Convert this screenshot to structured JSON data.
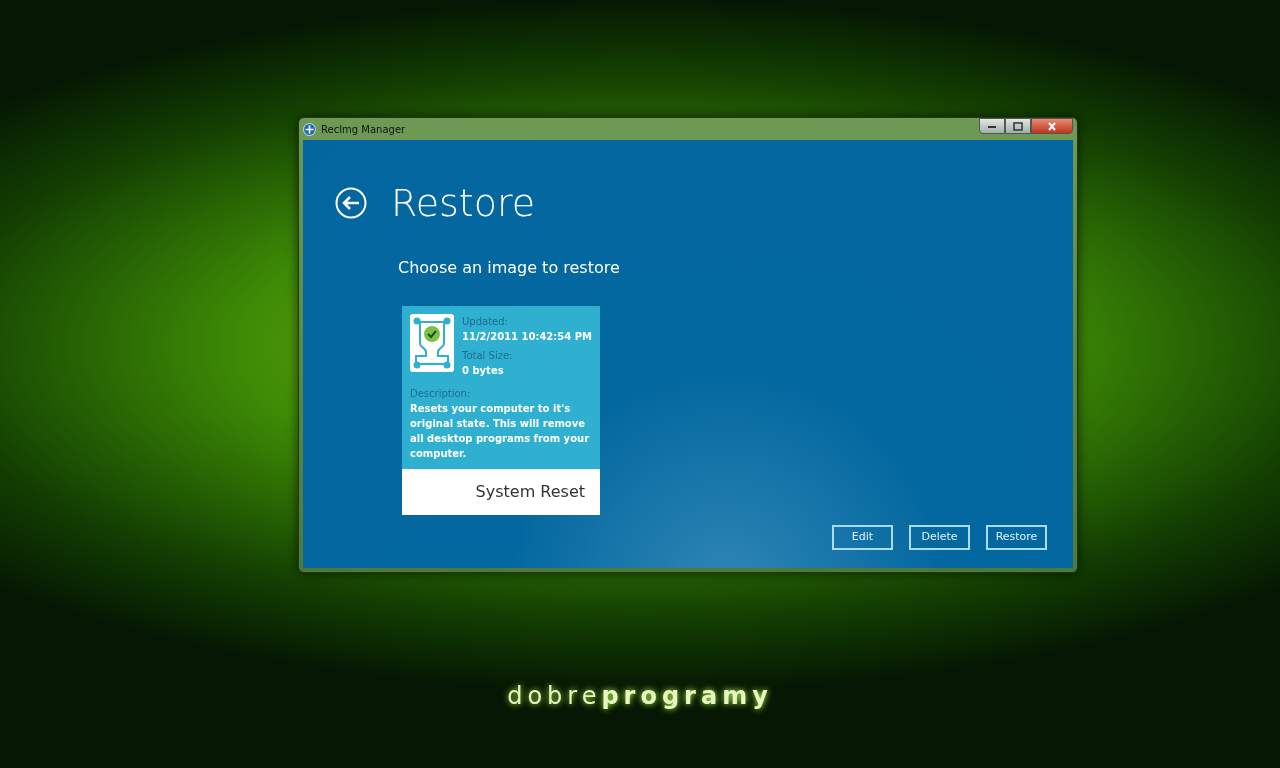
{
  "window": {
    "title": "RecImg Manager"
  },
  "page": {
    "title": "Restore",
    "subtitle": "Choose an image to restore"
  },
  "images": [
    {
      "updated_label": "Updated:",
      "updated": "11/2/2011 10:42:54 PM",
      "size_label": "Total Size:",
      "size": "0 bytes",
      "description_label": "Description:",
      "description": "Resets your computer to it's original state. This will remove all desktop programs from your computer.",
      "name": "System Reset"
    }
  ],
  "buttons": [
    "Edit",
    "Delete",
    "Restore"
  ],
  "wallpaper_text": "dobre**programy**"
}
